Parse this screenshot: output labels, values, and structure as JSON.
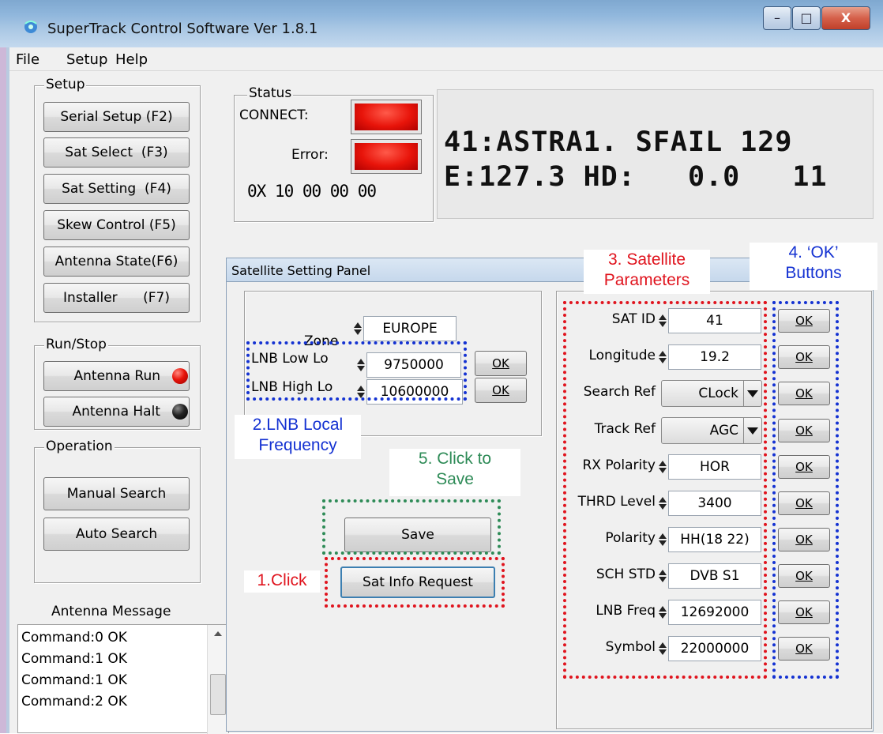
{
  "window": {
    "title": "SuperTrack Control Software Ver 1.8.1",
    "minimize": "–",
    "maximize": "□",
    "close": "X"
  },
  "menu": [
    "File",
    "Setup",
    "Help"
  ],
  "setup": {
    "legend": "Setup",
    "buttons": [
      "Serial Setup (F2)",
      "Sat Select  (F3)",
      "Sat Setting  (F4)",
      "Skew Control (F5)",
      "Antenna State(F6)",
      "Installer      (F7)"
    ]
  },
  "runstop": {
    "legend": "Run/Stop",
    "run": "Antenna Run",
    "halt": "Antenna Halt",
    "run_led_color": "#e8140a",
    "halt_led_color": "#111111"
  },
  "operation": {
    "legend": "Operation",
    "manual": "Manual Search",
    "auto": "Auto Search"
  },
  "antenna_message": {
    "label": "Antenna Message",
    "lines": [
      "Command:0 OK",
      "Command:1 OK",
      "Command:1 OK",
      "Command:2 OK"
    ]
  },
  "status": {
    "legend": "Status",
    "connect_label": "CONNECT:",
    "error_label": "Error:",
    "code": "0X 10 00 00 00",
    "led_color": "#e8140a"
  },
  "display": {
    "line1": "41:ASTRA1. SFAIL 129",
    "line2": "E:127.3 HD:   0.0   11"
  },
  "panel": {
    "title": "Satellite Setting Panel",
    "zone_label": "Zone",
    "zone_value": "EUROPE",
    "lnb_low_label": "LNB Low Lo",
    "lnb_low_value": "9750000",
    "lnb_high_label": "LNB High Lo",
    "lnb_high_value": "10600000",
    "ok_label": "OK",
    "save_label": "Save",
    "sat_info_label": "Sat Info Request"
  },
  "params": [
    {
      "label": "SAT ID",
      "value": "41",
      "kind": "spin"
    },
    {
      "label": "Longitude",
      "value": "19.2",
      "kind": "spin"
    },
    {
      "label": "Search Ref",
      "value": "CLock",
      "kind": "combo"
    },
    {
      "label": "Track Ref",
      "value": "AGC",
      "kind": "combo"
    },
    {
      "label": "RX Polarity",
      "value": "HOR",
      "kind": "spin"
    },
    {
      "label": "THRD Level",
      "value": "3400",
      "kind": "spin"
    },
    {
      "label": "Polarity",
      "value": "HH(18 22)",
      "kind": "spin"
    },
    {
      "label": "SCH STD",
      "value": "DVB S1",
      "kind": "spin"
    },
    {
      "label": "LNB Freq",
      "value": "12692000",
      "kind": "spin"
    },
    {
      "label": "Symbol",
      "value": "22000000",
      "kind": "spin"
    }
  ],
  "annotations": {
    "sat_params": "3. Satellite\nParameters",
    "ok_buttons": "4. ‘OK’\nButtons",
    "lnb_local": "2.LNB Local\nFrequency",
    "click_save": "5. Click to\nSave",
    "click": "1.Click",
    "red": "#e0141e",
    "blue": "#1432d2",
    "green": "#2e8b57"
  }
}
